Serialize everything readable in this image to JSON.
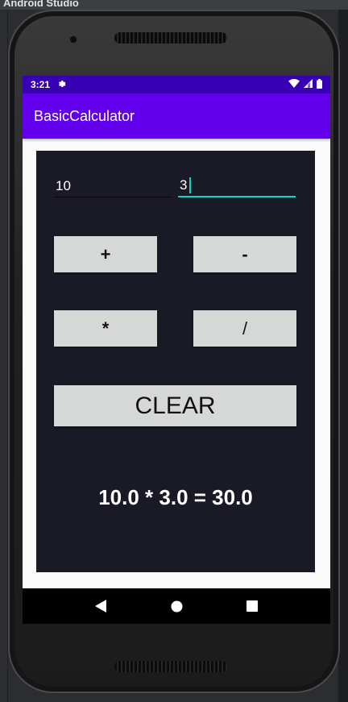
{
  "ide": {
    "window_title": "Android Studio"
  },
  "status_bar": {
    "time": "3:21"
  },
  "app_bar": {
    "title": "BasicCalculator"
  },
  "inputs": {
    "first_value": "10",
    "second_value": "3"
  },
  "buttons": {
    "add": "+",
    "subtract": "-",
    "multiply": "*",
    "divide": "/",
    "clear": "CLEAR"
  },
  "result": {
    "text": "10.0 * 3.0 = 30.0"
  },
  "colors": {
    "status_bar": "#3700b3",
    "app_bar": "#6200ee",
    "panel": "#1a1a26",
    "button": "#d6d7d7",
    "accent": "#03dac5"
  },
  "icons": {
    "status": [
      "settings-icon",
      "wifi-icon",
      "signal-icon",
      "battery-icon"
    ],
    "nav": [
      "back-icon",
      "home-icon",
      "recents-icon"
    ]
  }
}
